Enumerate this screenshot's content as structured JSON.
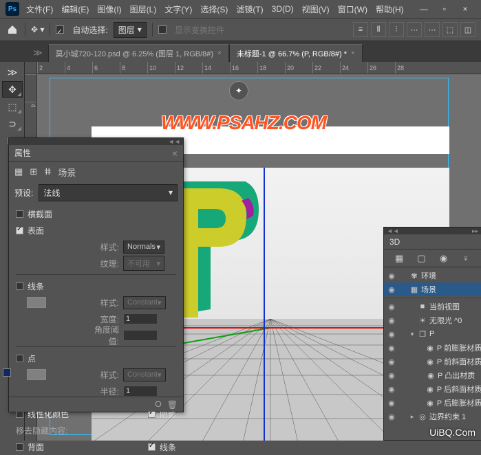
{
  "menu": {
    "items": [
      "文件(F)",
      "编辑(E)",
      "图像(I)",
      "图层(L)",
      "文字(Y)",
      "选择(S)",
      "滤镜(T)",
      "3D(D)",
      "视图(V)",
      "窗口(W)",
      "帮助(H)"
    ]
  },
  "window_controls": {
    "min": "—",
    "max": "▫",
    "close": "×"
  },
  "options": {
    "auto_select_label": "自动选择:",
    "layer_select": "图层",
    "show_transform": "显示变换控件"
  },
  "tabs": [
    {
      "label": "莫小城720-120.psd @ 6.25% (图层 1, RGB/8#)",
      "active": false
    },
    {
      "label": "未标题-1 @ 66.7% (P, RGB/8#) *",
      "active": true
    }
  ],
  "ruler_ticks": [
    "2",
    "4",
    "6",
    "8",
    "10",
    "12",
    "14",
    "16",
    "18",
    "20",
    "22",
    "24",
    "26",
    "28"
  ],
  "ruler_v_ticks": [
    "",
    "4"
  ],
  "watermark": "WWW.PSAHZ.COM",
  "watermark2": "UiBQ.Com",
  "props": {
    "title": "属性",
    "scene_label": "场景",
    "preset_label": "预设:",
    "preset_value": "法线",
    "cross_section": "横截面",
    "surface": "表面",
    "style_label": "样式:",
    "surface_style": "Normals",
    "texture_label": "纹理:",
    "texture_value": "不可用",
    "lines": "线条",
    "lines_style": "Constant",
    "width_label": "宽度:",
    "width_value": "1",
    "angle_label": "角度阈值:",
    "points": "点",
    "points_style": "Constant",
    "radius_label": "半径:",
    "radius_value": "1",
    "linearize": "线性化颜色",
    "shadow": "阴影",
    "hide_label": "移去隐藏内容:",
    "backface": "背面",
    "lines2": "线条"
  },
  "panel3d": {
    "title": "3D",
    "items": [
      {
        "eye": true,
        "indent": 0,
        "arrow": "",
        "icon": "✾",
        "label": "环境"
      },
      {
        "eye": true,
        "indent": 0,
        "arrow": "",
        "icon": "▦",
        "label": "场景",
        "sel": true
      },
      {
        "eye": true,
        "indent": 1,
        "arrow": "",
        "icon": "■",
        "label": "当前视图"
      },
      {
        "eye": true,
        "indent": 1,
        "arrow": "",
        "icon": "☀",
        "label": "无限光 ^0"
      },
      {
        "eye": true,
        "indent": 1,
        "arrow": "▾",
        "icon": "❐",
        "label": "P"
      },
      {
        "eye": true,
        "indent": 2,
        "arrow": "",
        "icon": "◉",
        "label": "P 前膨胀材质"
      },
      {
        "eye": true,
        "indent": 2,
        "arrow": "",
        "icon": "◉",
        "label": "P 前斜面材质"
      },
      {
        "eye": true,
        "indent": 2,
        "arrow": "",
        "icon": "◉",
        "label": "P 凸出材质"
      },
      {
        "eye": true,
        "indent": 2,
        "arrow": "",
        "icon": "◉",
        "label": "P 后斜面材质"
      },
      {
        "eye": true,
        "indent": 2,
        "arrow": "",
        "icon": "◉",
        "label": "P 后膨胀材质"
      },
      {
        "eye": true,
        "indent": 1,
        "arrow": "▸",
        "icon": "◎",
        "label": "边界约束 1"
      }
    ]
  }
}
